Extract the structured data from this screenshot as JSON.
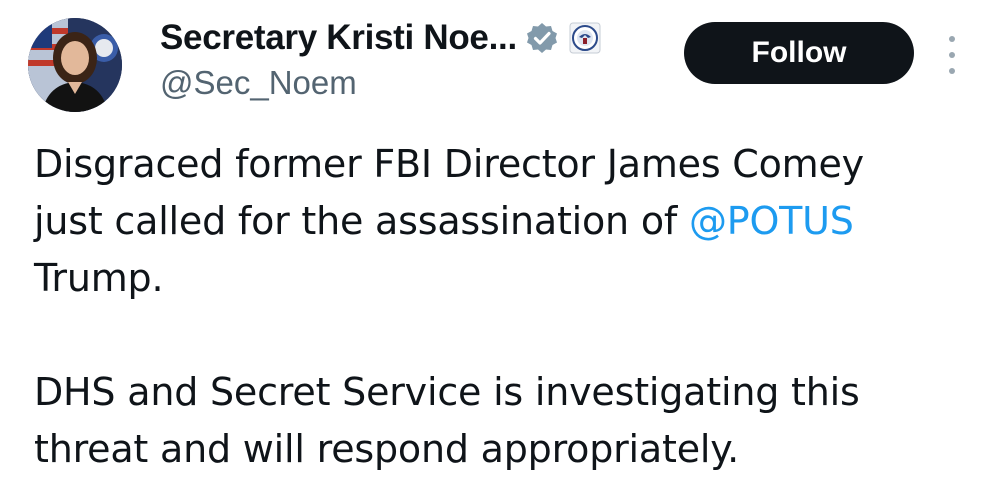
{
  "author": {
    "display_name": "Secretary Kristi Noe...",
    "handle": "@Sec_Noem",
    "avatar_icon": "profile-photo",
    "verified_icon": "verified-badge-icon",
    "affiliate_icon": "dhs-seal-icon"
  },
  "actions": {
    "follow_label": "Follow",
    "more_icon": "more-options-icon"
  },
  "tweet": {
    "line1": "Disgraced former FBI Director James Comey",
    "line2_prefix": "just called for the assassination of ",
    "line2_mention": "@POTUS",
    "line3": "Trump.",
    "line4": "DHS and Secret Service is investigating this",
    "line5": "threat and will respond appropriately."
  },
  "colors": {
    "text": "#0f1419",
    "secondary": "#536471",
    "link": "#1d9bf0",
    "button_bg": "#0f1419",
    "button_text": "#ffffff"
  }
}
